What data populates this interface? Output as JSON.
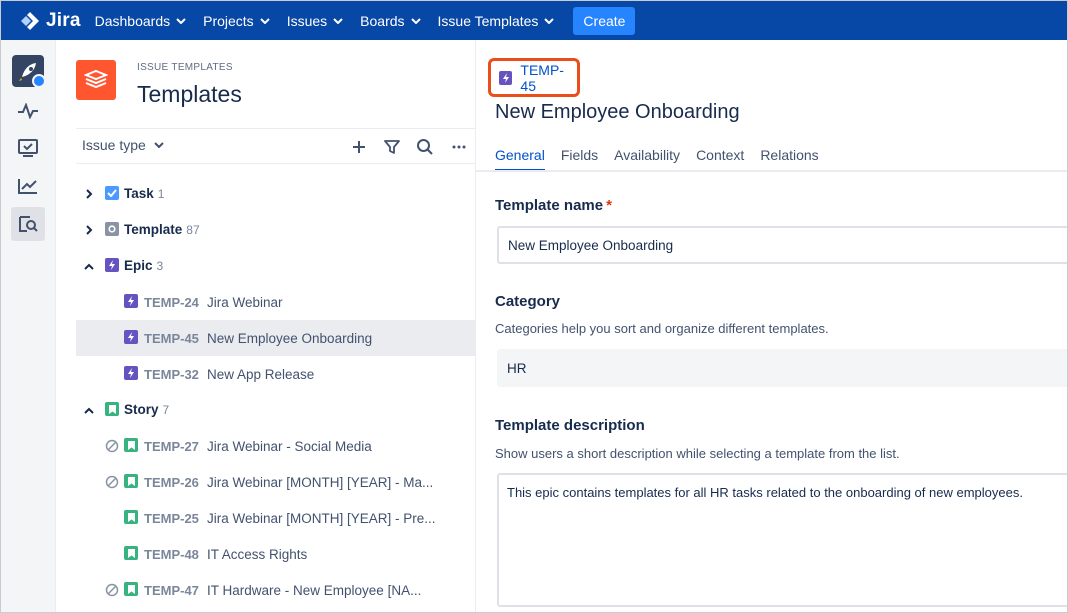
{
  "nav": {
    "brand": "Jira",
    "items": [
      {
        "label": "Dashboards"
      },
      {
        "label": "Projects"
      },
      {
        "label": "Issues"
      },
      {
        "label": "Boards"
      },
      {
        "label": "Issue Templates"
      }
    ],
    "create_label": "Create",
    "colors": {
      "bar": "#0747a6",
      "create": "#2684ff"
    }
  },
  "rail": {
    "icons": [
      "rocket-app-icon",
      "pulse-icon",
      "board-check-icon",
      "chart-trend-icon",
      "search-document-icon"
    ]
  },
  "left_panel": {
    "overline": "ISSUE TEMPLATES",
    "title": "Templates",
    "filter_label": "Issue type",
    "tools": [
      "add-icon",
      "filter-icon",
      "search-icon",
      "more-icon"
    ],
    "tree": [
      {
        "type": "group",
        "name": "Task",
        "count": "1",
        "expanded": false,
        "color": "#4c9aff",
        "icon": "task-checkbox-icon"
      },
      {
        "type": "group",
        "name": "Template",
        "count": "87",
        "expanded": false,
        "color": "#8993a4",
        "icon": "template-icon"
      },
      {
        "type": "group",
        "name": "Epic",
        "count": "3",
        "expanded": true,
        "color": "#6554c0",
        "icon": "epic-bolt-icon"
      },
      {
        "type": "item",
        "key": "TEMP-24",
        "summary": "Jira Webinar",
        "group": "epic",
        "blocked": false,
        "selected": false
      },
      {
        "type": "item",
        "key": "TEMP-45",
        "summary": "New Employee Onboarding",
        "group": "epic",
        "blocked": false,
        "selected": true
      },
      {
        "type": "item",
        "key": "TEMP-32",
        "summary": "New App Release",
        "group": "epic",
        "blocked": false,
        "selected": false
      },
      {
        "type": "group",
        "name": "Story",
        "count": "7",
        "expanded": true,
        "color": "#36b37e",
        "icon": "story-bookmark-icon"
      },
      {
        "type": "item",
        "key": "TEMP-27",
        "summary": "Jira Webinar - Social Media",
        "group": "story",
        "blocked": true,
        "selected": false
      },
      {
        "type": "item",
        "key": "TEMP-26",
        "summary": "Jira Webinar [MONTH] [YEAR] - Ma...",
        "group": "story",
        "blocked": true,
        "selected": false
      },
      {
        "type": "item",
        "key": "TEMP-25",
        "summary": "Jira Webinar [MONTH] [YEAR] - Pre...",
        "group": "story",
        "blocked": false,
        "selected": false
      },
      {
        "type": "item",
        "key": "TEMP-48",
        "summary": "IT Access Rights",
        "group": "story",
        "blocked": false,
        "selected": false
      },
      {
        "type": "item",
        "key": "TEMP-47",
        "summary": "IT Hardware - New Employee [NA...",
        "group": "story",
        "blocked": true,
        "selected": false
      }
    ]
  },
  "detail": {
    "issue_key": "TEMP-45",
    "title": "New Employee Onboarding",
    "tabs": [
      {
        "label": "General",
        "active": true
      },
      {
        "label": "Fields",
        "active": false
      },
      {
        "label": "Availability",
        "active": false
      },
      {
        "label": "Context",
        "active": false
      },
      {
        "label": "Relations",
        "active": false
      }
    ],
    "template_name": {
      "label": "Template name",
      "required_mark": "*",
      "value": "New Employee Onboarding"
    },
    "category": {
      "label": "Category",
      "help": "Categories help you sort and organize different templates.",
      "value": "HR"
    },
    "description": {
      "label": "Template description",
      "help": "Show users a short description while selecting a template from the list.",
      "value": "This epic contains templates for all HR tasks related to the onboarding of new employees."
    },
    "highlight_color": "#e94e1b"
  }
}
